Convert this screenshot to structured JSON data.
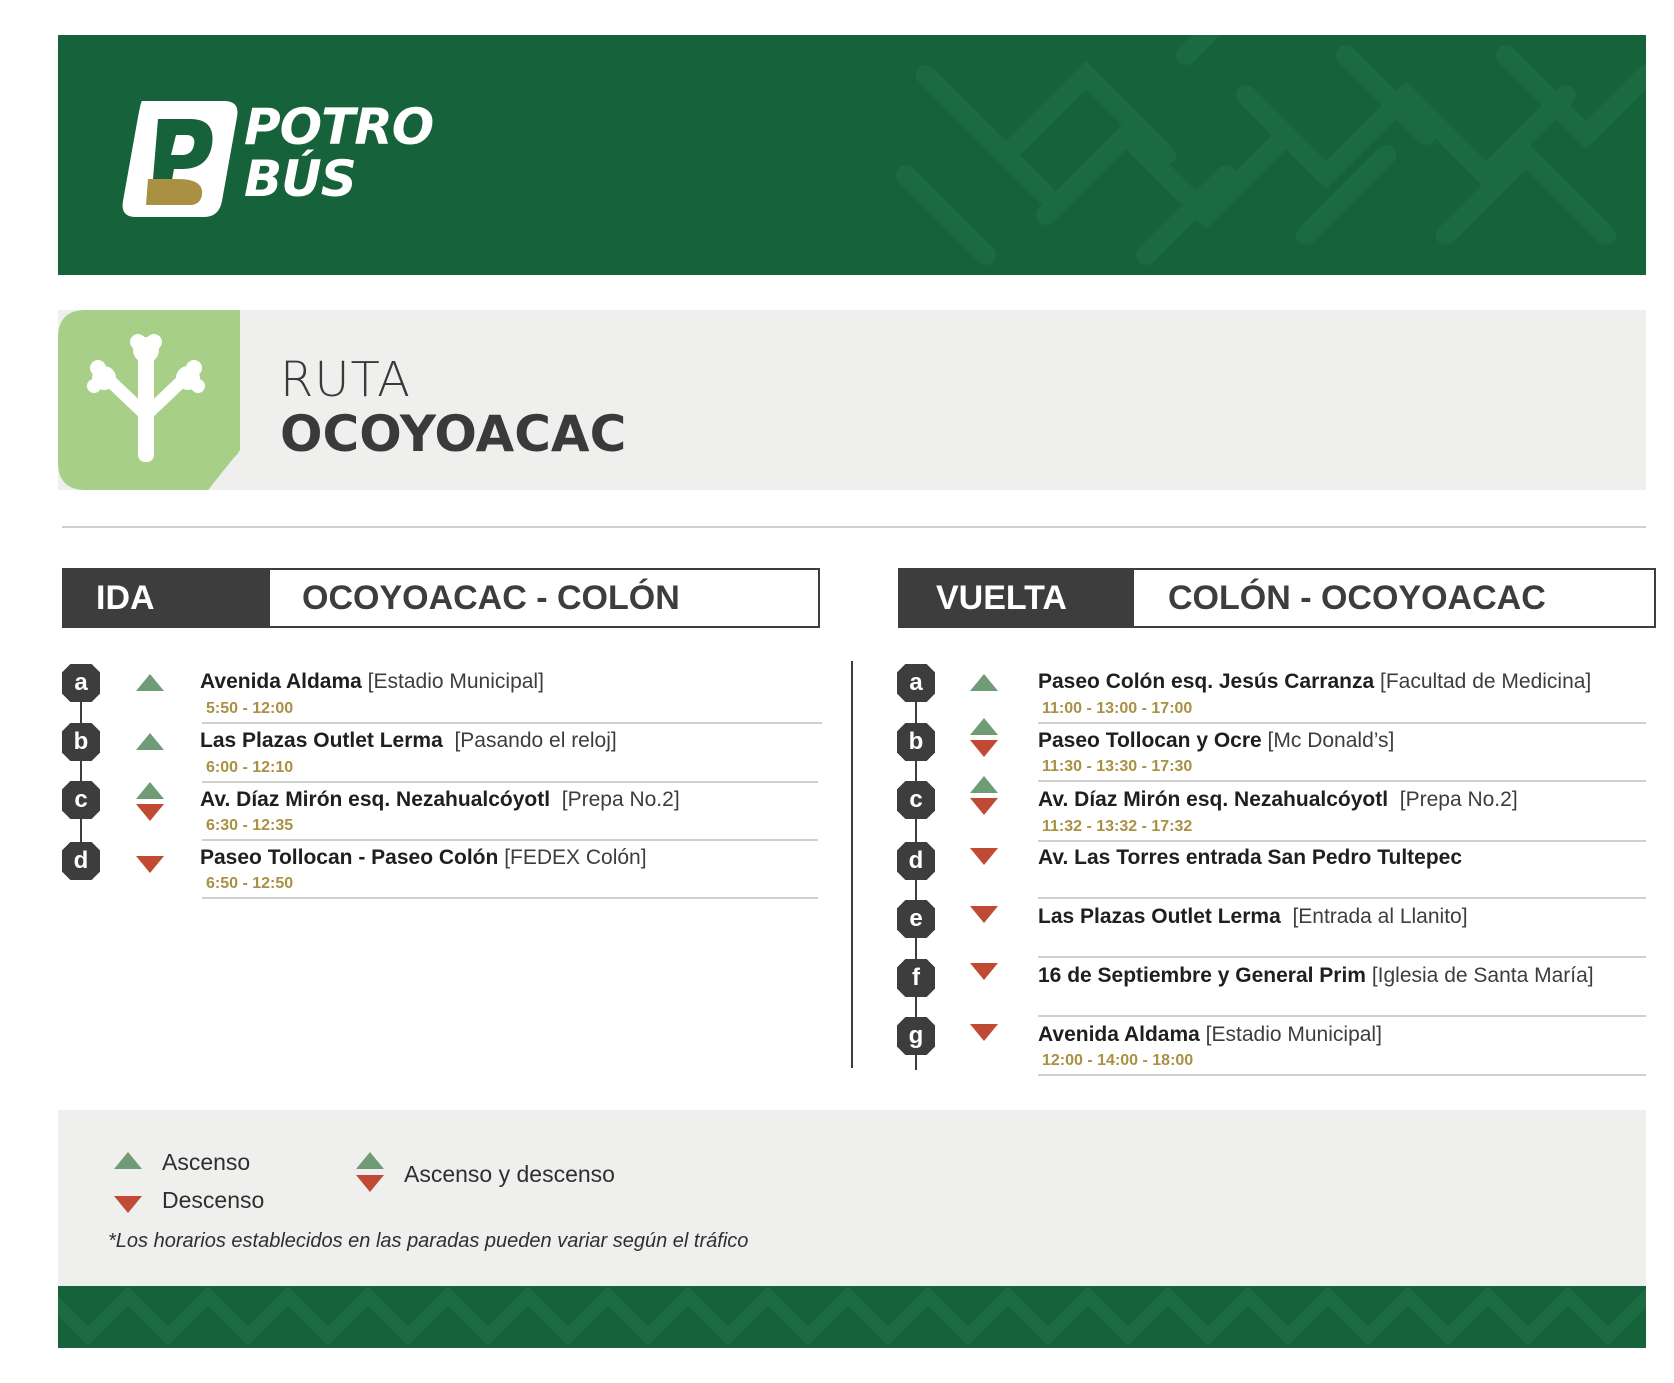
{
  "brand": {
    "logo_text_line1": "POTRO",
    "logo_text_line2": "BÚS",
    "logo_letter": "P"
  },
  "colors": {
    "green": "#16623b",
    "light_green": "#a7cf87",
    "dark": "#3d3d3d",
    "up": "#6f9c77",
    "down": "#c04a34",
    "time": "#a99043"
  },
  "route": {
    "label": "RUTA",
    "name": "OCOYOACAC",
    "icon": "tree-icon"
  },
  "ida": {
    "label": "IDA",
    "title": "OCOYOACAC - COLÓN",
    "stops": [
      {
        "letter": "a",
        "type": "up",
        "name": "Avenida Aldama",
        "note": "[Estadio Municipal]",
        "time": "5:50 - 12:00"
      },
      {
        "letter": "b",
        "type": "up",
        "name": "Las Plazas Outlet Lerma",
        "note": "[Pasando el reloj]",
        "time": "6:00 - 12:10"
      },
      {
        "letter": "c",
        "type": "both",
        "name": "Av. Díaz Mirón esq. Nezahualcóyotl",
        "note": "[Prepa No.2]",
        "time": "6:30 - 12:35"
      },
      {
        "letter": "d",
        "type": "down",
        "name": "Paseo Tollocan - Paseo Colón",
        "note": "[FEDEX Colón]",
        "time": "6:50 - 12:50"
      }
    ]
  },
  "vuelta": {
    "label": "VUELTA",
    "title": "COLÓN - OCOYOACAC",
    "stops": [
      {
        "letter": "a",
        "type": "up",
        "name": "Paseo Colón esq. Jesús Carranza",
        "note": "[Facultad de Medicina]",
        "time": "11:00 - 13:00 - 17:00"
      },
      {
        "letter": "b",
        "type": "both",
        "name": "Paseo Tollocan y Ocre",
        "note": "[Mc Donald’s]",
        "time": "11:30 - 13:30 - 17:30"
      },
      {
        "letter": "c",
        "type": "both",
        "name": "Av. Díaz Mirón esq. Nezahualcóyotl",
        "note": "[Prepa No.2]",
        "time": "11:32 - 13:32 - 17:32"
      },
      {
        "letter": "d",
        "type": "down",
        "name": "Av. Las Torres entrada San Pedro Tultepec",
        "note": "",
        "time": ""
      },
      {
        "letter": "e",
        "type": "down",
        "name": "Las Plazas Outlet Lerma",
        "note": "[Entrada al Llanito]",
        "time": ""
      },
      {
        "letter": "f",
        "type": "down",
        "name": "16 de Septiembre y General Prim",
        "note": "[Iglesia de Santa María]",
        "time": ""
      },
      {
        "letter": "g",
        "type": "down",
        "name": "Avenida Aldama",
        "note": "[Estadio Municipal]",
        "time": "12:00 - 14:00 - 18:00"
      }
    ]
  },
  "legend": {
    "ascenso": "Ascenso",
    "descenso": "Descenso",
    "ambos": "Ascenso y descenso",
    "footnote": "*Los horarios establecidos en las paradas pueden variar según el tráfico"
  }
}
